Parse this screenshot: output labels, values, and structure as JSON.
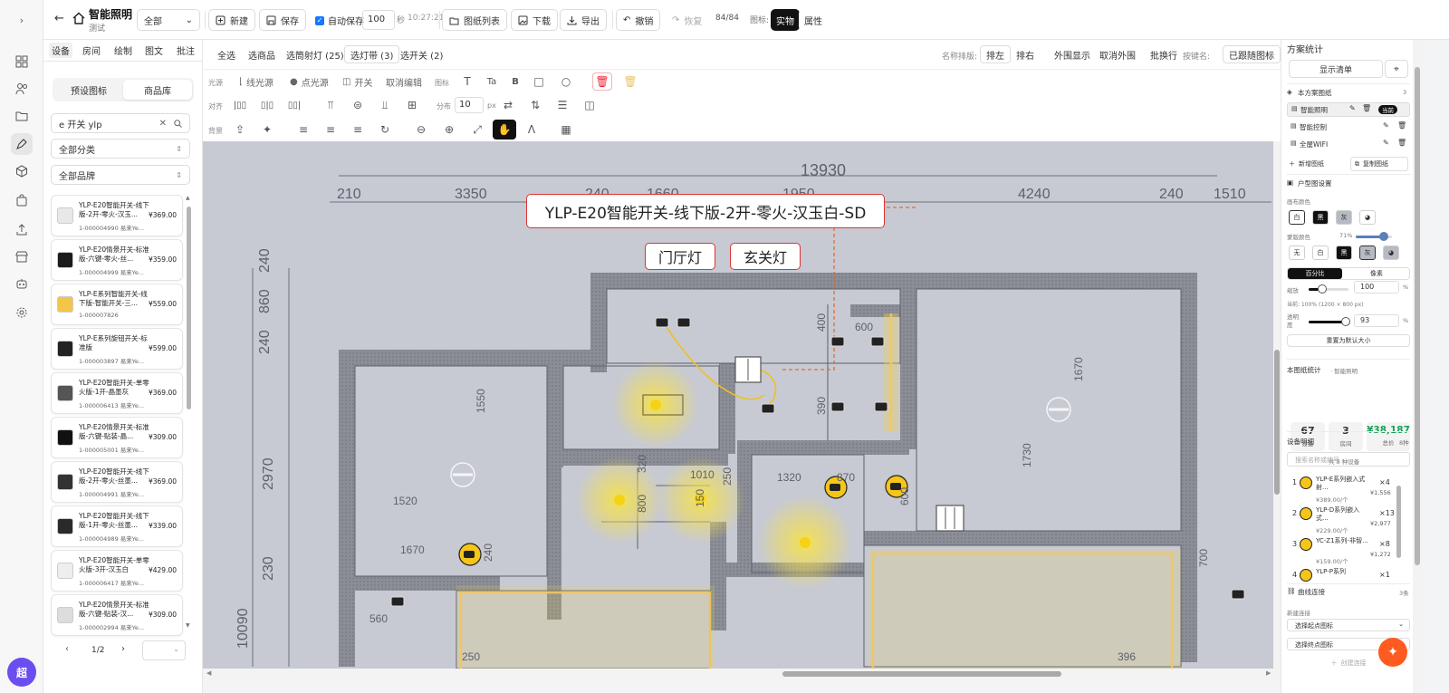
{
  "rail": {
    "collapse": "›",
    "avatar": "超"
  },
  "topbar": {
    "back": "←",
    "project_title": "智能照明",
    "project_sub": "测试",
    "scope_select": "全部",
    "new_label": "新建",
    "save_label": "保存",
    "autosave_label": "自动保存",
    "autosave_value": "100",
    "autosave_unit": "秒",
    "autosave_time": "10:27:21",
    "drawing_list": "图纸列表",
    "download": "下载",
    "export": "导出",
    "undo": "撤销",
    "redo": "恢复",
    "history_count": "84/84",
    "icon_label": "图标:",
    "mode_real": "实物",
    "mode_attr": "属性"
  },
  "left": {
    "tabs": [
      "设备",
      "房间",
      "绘制",
      "图文",
      "批注"
    ],
    "seg": [
      "预设图标",
      "商品库"
    ],
    "search_value": "e 开关 ylp",
    "category": "全部分类",
    "brand": "全部品牌",
    "products": [
      {
        "name": "YLP-E20智能开关-线下版-2开-零火-汉玉...",
        "sku": "1-000004990 易来Ye...",
        "price": "¥369.00",
        "color": "#e8e8e8"
      },
      {
        "name": "YLP-E20情景开关-标准版-六键-零火-丝...",
        "sku": "1-000004999 易来Ye...",
        "price": "¥359.00",
        "color": "#1b1b1b"
      },
      {
        "name": "YLP-E系列智能开关-线下版-智能开关-三...",
        "sku": "1-000007826",
        "price": "¥559.00",
        "color": "#f3c64a"
      },
      {
        "name": "YLP-E系列旋钮开关-标准版",
        "sku": "1-000003897 易来Ye...",
        "price": "¥599.00",
        "color": "#222222"
      },
      {
        "name": "YLP-E20智能开关-单零火版-1开-晶墨灰",
        "sku": "1-000006413 易来Ye...",
        "price": "¥369.00",
        "color": "#555555"
      },
      {
        "name": "YLP-E20情景开关-标准版-六键-贴装-晶...",
        "sku": "1-000005001 易来Ye...",
        "price": "¥309.00",
        "color": "#111111"
      },
      {
        "name": "YLP-E20智能开关-线下版-2开-零火-丝墨...",
        "sku": "1-000004991 易来Ye...",
        "price": "¥369.00",
        "color": "#333333"
      },
      {
        "name": "YLP-E20智能开关-线下版-1开-零火-丝墨...",
        "sku": "1-000004989 易来Ye...",
        "price": "¥339.00",
        "color": "#2a2a2a"
      },
      {
        "name": "YLP-E20智能开关-单零火版-3开-汉玉白",
        "sku": "1-000006417 易来Ye...",
        "price": "¥429.00",
        "color": "#eeeeee"
      },
      {
        "name": "YLP-E20情景开关-标准版-六键-贴装-汉...",
        "sku": "1-000002994 易来Ye...",
        "price": "¥309.00",
        "color": "#dddddd"
      }
    ],
    "page": "1/2"
  },
  "ctool": {
    "row1": [
      "全选",
      "选商品",
      "选筒射灯 (25)",
      "选灯带 (3)",
      "选开关 (2)"
    ],
    "sort_label": "名称排版:",
    "row1_right": [
      "排左",
      "排右",
      "外围显示",
      "取消外围",
      "批换行"
    ],
    "key_label": "按键名:",
    "key_btn": "已跟随图标",
    "light_label": "光源",
    "light_items": [
      "线光源",
      "点光源",
      "开关",
      "取消编辑"
    ],
    "icon_label": "图标",
    "align_label": "对齐",
    "dist_label": "分布",
    "dist_value": "10",
    "dist_unit": "px",
    "bg_label": "背景"
  },
  "canvas": {
    "label_main": "YLP-E20智能开关-线下版-2开-零火-汉玉白-SD",
    "label_a": "门厅灯",
    "label_b": "玄关灯",
    "dims": [
      "13930",
      "210",
      "3350",
      "240",
      "1660",
      "1950",
      "4240",
      "240",
      "1510",
      "240",
      "860",
      "240",
      "2970",
      "230",
      "10090",
      "1550",
      "1520",
      "1670",
      "1320",
      "870",
      "1010",
      "600",
      "400",
      "390",
      "1670",
      "1730",
      "560",
      "700",
      "250",
      "396",
      "320",
      "800",
      "150",
      "250",
      "600",
      "240"
    ]
  },
  "right": {
    "title": "方案统计",
    "show_list": "显示清单",
    "drawings_title": "本方案图纸",
    "drawings_count": "3",
    "drawings": [
      {
        "name": "智能照明",
        "badge": "当前"
      },
      {
        "name": "智能控制",
        "badge": ""
      },
      {
        "name": "全屋WIFI",
        "badge": ""
      }
    ],
    "new_drawing": "新增图纸",
    "copy_drawing": "复制图纸",
    "plan_title": "户型图设置",
    "canvas_color": "画布颜色",
    "canvas_swatches": [
      "白",
      "黑",
      "灰"
    ],
    "mask_color": "蒙版颜色",
    "mask_value": "71%",
    "mask_swatches": [
      "无",
      "白",
      "黑",
      "灰"
    ],
    "unit_pct": "百分比",
    "unit_px": "像素",
    "zoom_label": "缩放",
    "zoom_value": "100",
    "zoom_unit": "%",
    "zoom_level": 0.35,
    "current_size": "当前: 100% (1200 × 800 px)",
    "opacity_label": "透明度",
    "opacity_value": "93",
    "opacity_level": 0.93,
    "reset": "重置为默认大小",
    "stats_title": "本图纸统计",
    "stats_sub": "· 智能照明",
    "stat_devices": "67",
    "stat_devices_label": "设备",
    "stat_rooms": "3",
    "stat_rooms_label": "房间",
    "stat_total": "¥38,187",
    "stat_total_label": "总价",
    "stat_kinds": "共 8 种设备",
    "devices_title": "设备明细",
    "devices_count": "8种",
    "devices_search": "搜索名称或编号",
    "devices": [
      {
        "idx": "1",
        "name": "YLP-E系列嵌入式射...",
        "unit": "¥389.00/个",
        "qty": "×4",
        "sum": "¥1,556"
      },
      {
        "idx": "2",
        "name": "YLP-D系列嵌入式...",
        "unit": "¥229.00/个",
        "qty": "×13",
        "sum": "¥2,977"
      },
      {
        "idx": "3",
        "name": "YC-Z1系列-非智...",
        "unit": "¥159.00/个",
        "qty": "×8",
        "sum": "¥1,272"
      },
      {
        "idx": "4",
        "name": "YLP-P系列",
        "unit": "",
        "qty": "×1",
        "sum": ""
      }
    ],
    "curve_title": "曲线连接",
    "curve_count": "3条",
    "new_conn": "新建连接",
    "pick_start": "选择起点图标",
    "pick_end": "选择终点图标",
    "create_conn": "创建连接"
  },
  "colors": {
    "accent": "#111111",
    "highlight": "#f4e14a",
    "label_border": "#dd3333",
    "total_green": "#18a058",
    "fab": "#ff5a1f"
  }
}
